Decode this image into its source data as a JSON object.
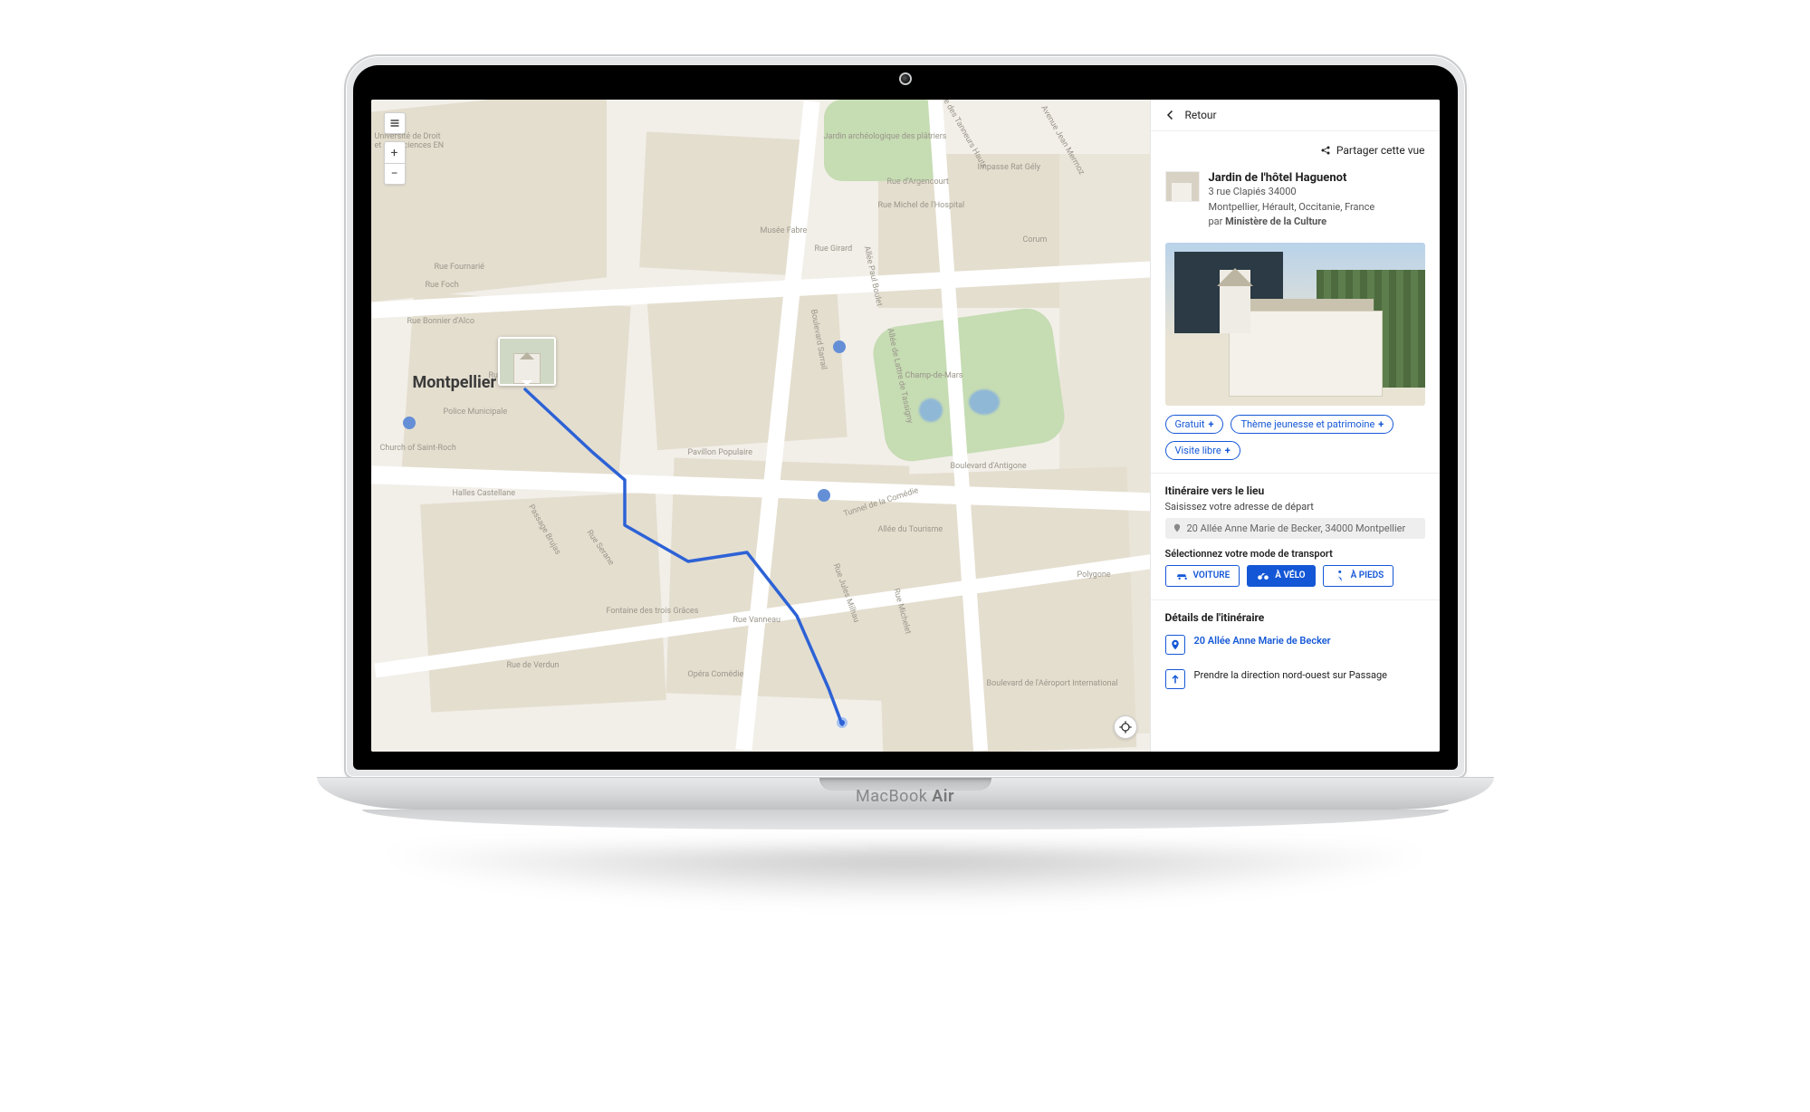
{
  "brand": {
    "name": "MacBook",
    "suffix": "Air"
  },
  "map": {
    "city_label": "Montpellier",
    "street_labels": [
      "Jardin archéologique des plâtriers",
      "Rue d'Argencourt",
      "Rue Michel de l'Hospital",
      "Rue Girard",
      "Boulevard Sarrail",
      "Avenue Jean Mermoz",
      "Allée de Lattre de Tassigny",
      "Champ-de-Mars",
      "Boulevard d'Antigone",
      "Allée Paul Boulet",
      "Tunnel de la Comédie",
      "Allée du Tourisme",
      "Rue Jules Milhau",
      "Rue Michelet",
      "Rue Vanneau",
      "Fontaine des trois Grâces",
      "Opéra Comédie",
      "Boulevard de l'Aéroport International",
      "Pavillon Populaire",
      "Corum",
      "Polygone",
      "Musée Fabre",
      "Passage Brujas",
      "Rue Serane",
      "Rue de Verdun",
      "Impasse Rat Gély",
      "Impasse des Tanneurs Hauts",
      "Rue Foch",
      "Rue Fournarié",
      "Rue Bonnier d'Alco",
      "Rue de l'Aiguillerie",
      "Church of Saint-Roch",
      "Police Municipale",
      "Halles Castellane",
      "Université de Droit et des Sciences EN"
    ]
  },
  "panel": {
    "back": "Retour",
    "share": "Partager cette vue",
    "title": "Jardin de l'hôtel Haguenot",
    "addr1": "3 rue Clapiés 34000",
    "addr2": "Montpellier, Hérault, Occitanie, France",
    "by_prefix": "par ",
    "by": "Ministère de la Culture",
    "tags": [
      "Gratuit",
      "Thème jeunesse et patrimoine",
      "Visite libre"
    ],
    "itin_title": "Itinéraire vers le lieu",
    "addr_hint": "Saisissez votre adresse de départ",
    "addr_value": "20 Allée Anne Marie de Becker, 34000 Montpellier",
    "mode_title": "Sélectionnez votre mode de transport",
    "modes": [
      {
        "id": "car",
        "label": "VOITURE"
      },
      {
        "id": "bike",
        "label": "À VÉLO"
      },
      {
        "id": "walk",
        "label": "À PIEDS"
      }
    ],
    "details_title": "Détails de l'itinéraire",
    "steps": [
      {
        "icon": "pin",
        "text": "20 Allée Anne Marie de Becker",
        "link": true
      },
      {
        "icon": "arrow",
        "text": "Prendre la direction nord-ouest sur Passage",
        "link": false
      }
    ]
  }
}
